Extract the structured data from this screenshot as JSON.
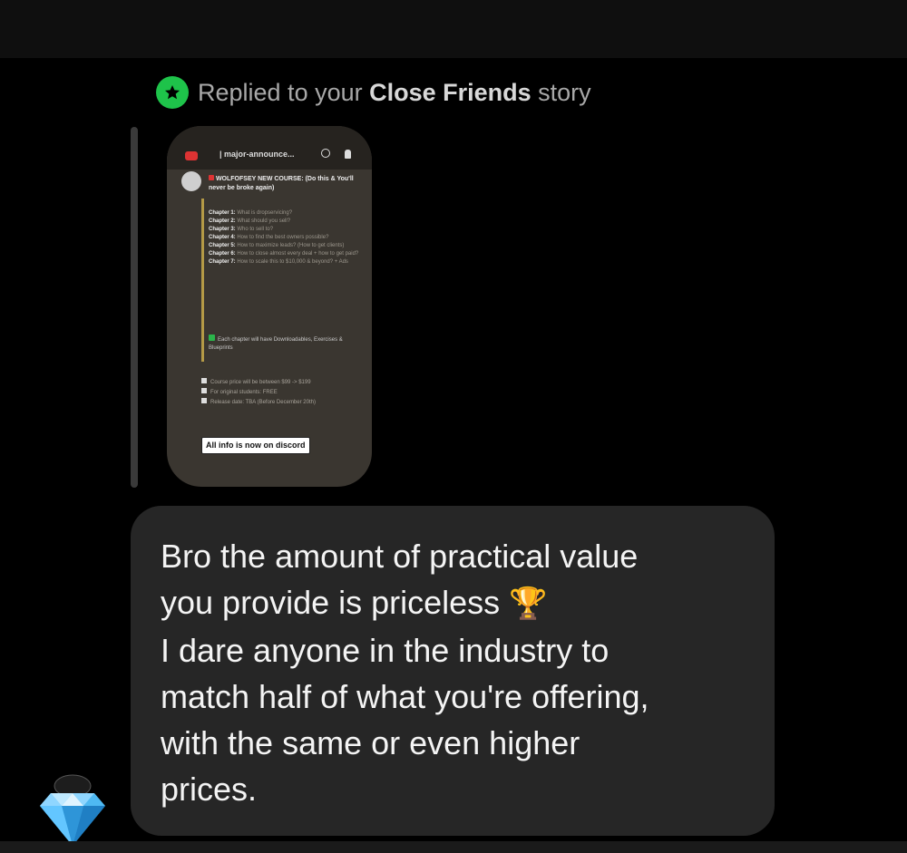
{
  "reply_header": {
    "prefix": "Replied to your ",
    "audience": "Close Friends",
    "suffix": " story",
    "badge_icon": "star-icon",
    "badge_color": "#1ec34a"
  },
  "story": {
    "channel_name": "| major-announce...",
    "post_title": "WOLFOFSEY NEW COURSE: (Do this & You'll never be broke again)",
    "chapters": [
      {
        "label": "Chapter 1:",
        "text": "What is dropservicing?"
      },
      {
        "label": "Chapter 2:",
        "text": "What should you sell?"
      },
      {
        "label": "Chapter 3:",
        "text": "Who to sell to?"
      },
      {
        "label": "Chapter 4:",
        "text": "How to find the best owners possible?"
      },
      {
        "label": "Chapter 5:",
        "text": "How to maximize leads? (How to get clients)"
      },
      {
        "label": "Chapter 6:",
        "text": "How to close almost every deal + how to get paid?"
      },
      {
        "label": "Chapter 7:",
        "text": "How to scale this to $10,000 & beyond? + Ads"
      }
    ],
    "bonus_note": "Each chapter will have Downloadables, Exercises & Blueprints",
    "notes": [
      "Course price will be between $99 -> $199",
      "For original students: FREE",
      "Release date: TBA (Before December 20th)"
    ],
    "info_pill": "All info is now on discord"
  },
  "message": {
    "lines": [
      "Bro the amount of practical value",
      "you provide is priceless",
      "I dare anyone in the industry to",
      "match half of what you're offering,",
      "with the same or even higher",
      "prices."
    ],
    "emoji": "🏆"
  },
  "sender": {
    "avatar_icon": "diamond-icon"
  }
}
